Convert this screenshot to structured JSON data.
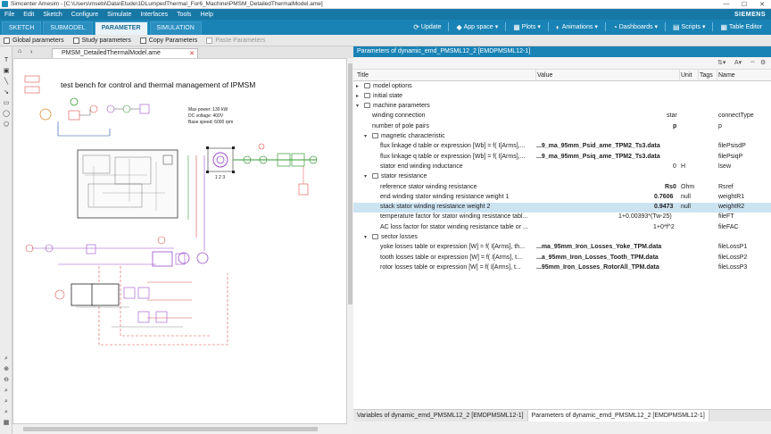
{
  "window": {
    "title": "Simcenter Amesim - [C:\\Users\\msebi\\Data\\Etude\\1DLumpedThermal_For6_Machine\\PMSM_DetailedThermalModel.ame]",
    "controls": [
      "—",
      "☐",
      "✕"
    ]
  },
  "menu": {
    "items": [
      "File",
      "Edit",
      "Sketch",
      "Configure",
      "Simulate",
      "Interfaces",
      "Tools",
      "Help"
    ],
    "brand": "SIEMENS"
  },
  "modes": {
    "tabs": [
      "SKETCH",
      "SUBMODEL",
      "PARAMETER",
      "SIMULATION"
    ],
    "active": "PARAMETER"
  },
  "toolbar": {
    "update": "Update",
    "app_space": "App space",
    "plots": "Plots",
    "animations": "Animations",
    "dashboards": "Dashboards",
    "scripts": "Scripts",
    "table_editor": "Table Editor"
  },
  "subtoolbar": {
    "global_parameters": "Global parameters",
    "study_parameters": "Study parameters",
    "copy_parameters": "Copy Parameters",
    "paste_parameters": "Paste Parameters"
  },
  "sketch": {
    "tab": "PMSM_DetailedThermalModel.ame",
    "heading": "test bench for control and thermal management of IPMSM",
    "specs": [
      "Max power: 130 kW",
      "DC voltage: 400V",
      "Base speed: 6000 rpm"
    ],
    "port_labels": "1  2  3"
  },
  "params": {
    "panel_title": "Parameters of dynamic_emd_PMSML12_2 [EMDPMSML12-1]",
    "columns": {
      "title": "Title",
      "value": "Value",
      "unit": "Unit",
      "tags": "Tags",
      "name": "Name"
    },
    "rows": [
      {
        "title": "model options",
        "value": "",
        "unit": "",
        "name": ""
      },
      {
        "title": "initial state",
        "value": "",
        "unit": "",
        "name": ""
      },
      {
        "title": "machine parameters",
        "value": "",
        "unit": "",
        "name": ""
      },
      {
        "title": "winding connection",
        "value": "star",
        "unit": "",
        "name": "connectType"
      },
      {
        "title": "number of pole pairs",
        "value": "p",
        "unit": "",
        "name": "p"
      },
      {
        "title": "magnetic characteristic",
        "value": "",
        "unit": "",
        "name": ""
      },
      {
        "title": "flux linkage d table or expression [Wb] = f( I[Arms],...",
        "value": "...9_ma_95mm_Psid_ame_TPM2_Ts3.data",
        "unit": "",
        "name": "filePsisdP"
      },
      {
        "title": "flux linkage q table or expression [Wb] = f( I[Arms],...",
        "value": "...9_ma_95mm_Psiq_ame_TPM2_Ts3.data",
        "unit": "",
        "name": "filePsiqP"
      },
      {
        "title": "stator end winding inductance",
        "value": "0",
        "unit": "H",
        "name": "lsew"
      },
      {
        "title": "stator resistance",
        "value": "",
        "unit": "",
        "name": ""
      },
      {
        "title": "reference stator winding resistance",
        "value": "Rs0",
        "unit": "Ohm",
        "name": "Rsref"
      },
      {
        "title": "end winding stator winding resistance weight 1",
        "value": "0.7606",
        "unit": "null",
        "name": "weightR1"
      },
      {
        "title": "stack stator winding resistance weight 2",
        "value": "0.9473",
        "unit": "null",
        "name": "weightR2"
      },
      {
        "title": "temperature factor for stator winding resistance tabl...",
        "value": "1+0.00393*(Tw-25)",
        "unit": "",
        "name": "fileFT"
      },
      {
        "title": "AC loss factor for stator winding resistance table or ...",
        "value": "1+0*f^2",
        "unit": "",
        "name": "fileFAC"
      },
      {
        "title": "sector losses",
        "value": "",
        "unit": "",
        "name": ""
      },
      {
        "title": "yoke losses table or expression [W] = f( I[Arms], th...",
        "value": "...ma_95mm_Iron_Losses_Yoke_TPM.data",
        "unit": "",
        "name": "fileLossP1"
      },
      {
        "title": "tooth losses table or expression [W] = f( I[Arms], t...",
        "value": "...a_95mm_Iron_Losses_Tooth_TPM.data",
        "unit": "",
        "name": "fileLossP2"
      },
      {
        "title": "rotor losses table or expression [W] = f( I[Arms], t...",
        "value": "...95mm_Iron_Losses_RotorAll_TPM.data",
        "unit": "",
        "name": "fileLossP3"
      }
    ]
  },
  "bottom_tabs": [
    "Variables of dynamic_emd_PMSML12_2 [EMDPMSML12-1]",
    "Parameters of dynamic_emd_PMSML12_2 [EMDPMSML12-1]"
  ],
  "colors": {
    "accent": "#1a83b5",
    "selection": "#cce4f2",
    "sketch_red": "#d9534f",
    "sketch_purple": "#9b4dca",
    "sketch_green": "#3a9a3a"
  }
}
